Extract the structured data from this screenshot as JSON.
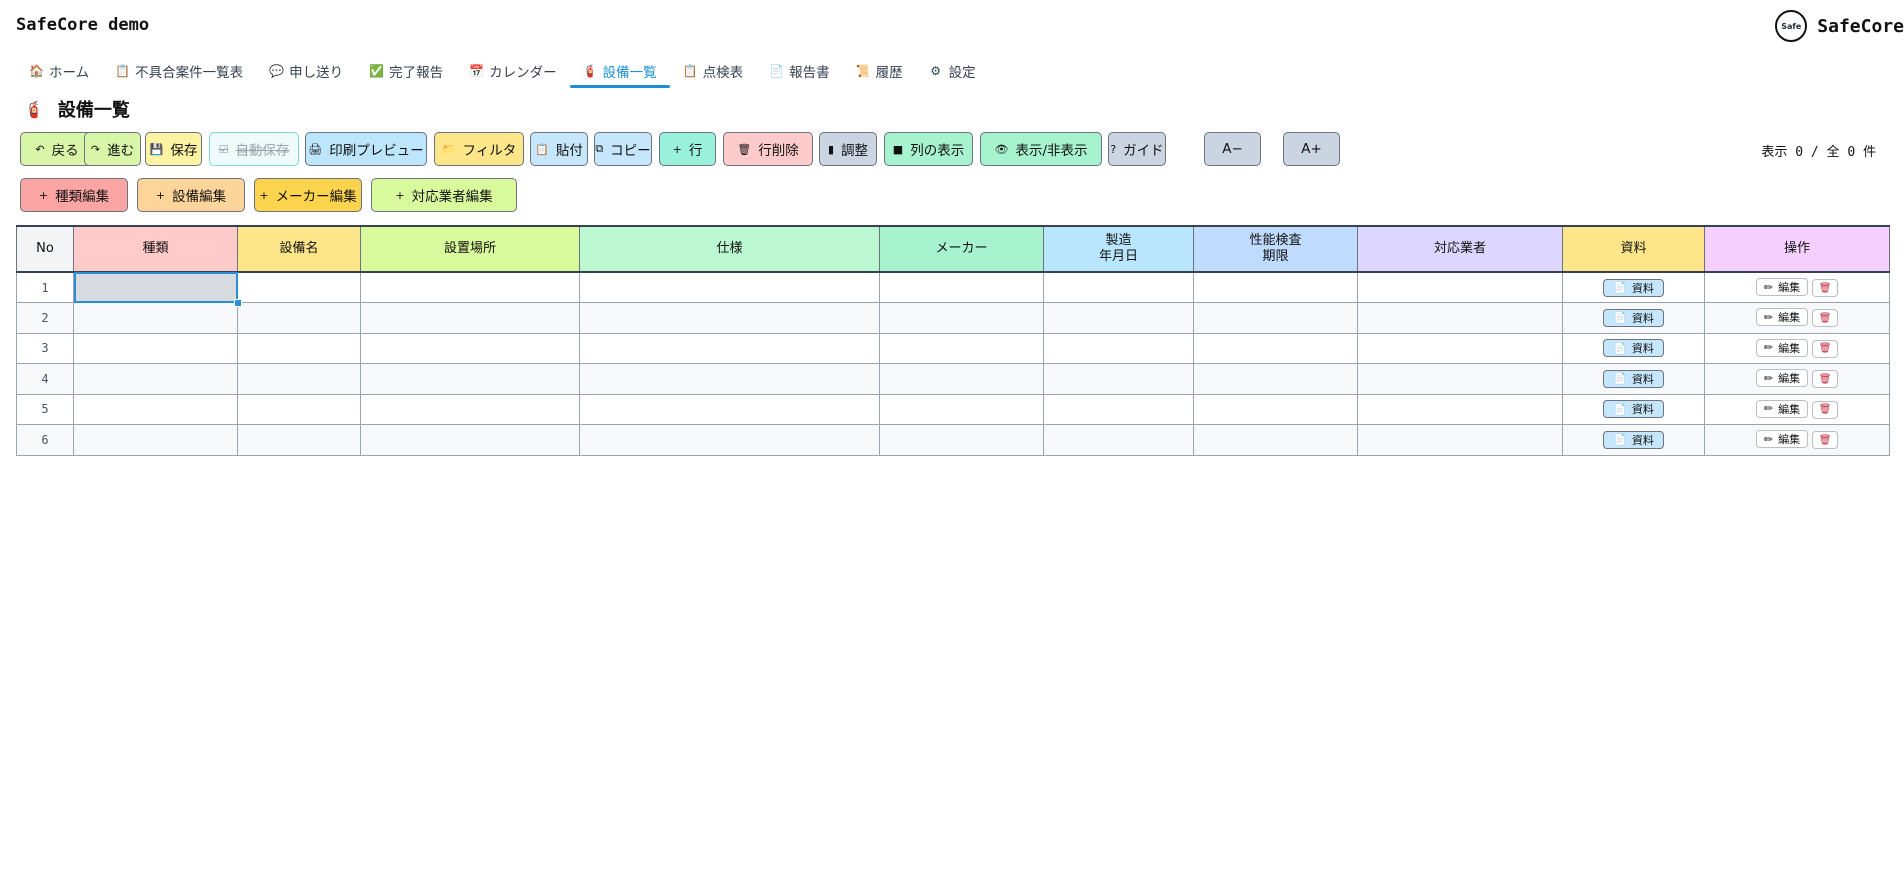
{
  "app": {
    "title": "SafeCore demo",
    "brand": "SafeCore",
    "logo_text": "Safe"
  },
  "nav": [
    {
      "icon": "🏠",
      "label": "ホーム"
    },
    {
      "icon": "📋",
      "label": "不具合案件一覧表"
    },
    {
      "icon": "💬",
      "label": "申し送り"
    },
    {
      "icon": "✅",
      "label": "完了報告"
    },
    {
      "icon": "📅",
      "label": "カレンダー"
    },
    {
      "icon": "🧯",
      "label": "設備一覧",
      "active": true
    },
    {
      "icon": "📋",
      "label": "点検表"
    },
    {
      "icon": "📄",
      "label": "報告書"
    },
    {
      "icon": "📜",
      "label": "履歴"
    },
    {
      "icon": "⚙",
      "label": "設定"
    }
  ],
  "page": {
    "icon": "🧯",
    "title": "設備一覧"
  },
  "toolbar": {
    "buttons": [
      {
        "icon": "↶",
        "label": "戻る",
        "color": "#d8f5a8"
      },
      {
        "icon": "↷",
        "label": "進む",
        "color": "#d8f5a8"
      },
      {
        "icon": "💾",
        "label": "保存",
        "color": "#fdf3a3"
      },
      {
        "icon": "☑",
        "label": "自動保存",
        "color": "#eefbfa",
        "disabled": true
      },
      {
        "icon": "🖨",
        "label": "印刷プレビュー",
        "color": "#bde5fb"
      },
      {
        "icon": "📁",
        "label": "フィルタ",
        "color": "#fde68a"
      },
      {
        "icon": "📋",
        "label": "貼付",
        "color": "#c6e6fb"
      },
      {
        "icon": "⧉",
        "label": "コピー",
        "color": "#c6e6fb"
      },
      {
        "icon": "+",
        "label": "行",
        "color": "#99f1dc"
      },
      {
        "icon": "🗑",
        "label": "行削除",
        "color": "#fecaca"
      },
      {
        "icon": "▮",
        "label": "調整",
        "color": "#cbd5e1"
      },
      {
        "icon": "■",
        "label": "列の表示",
        "color": "#a7f3d0"
      },
      {
        "icon": "👁",
        "label": "表示/非表示",
        "color": "#a7f3d0"
      },
      {
        "icon": "?",
        "label": "ガイド",
        "color": "#cbd5e1"
      },
      {
        "icon": "",
        "label": "A−",
        "color": "#cbd5e1"
      },
      {
        "icon": "",
        "label": "A+",
        "color": "#cbd5e1"
      }
    ],
    "count_label": "表示 0 / 全 0 件"
  },
  "toolbar2": {
    "buttons": [
      {
        "icon": "+",
        "label": "種類編集",
        "color": "#fca5a5"
      },
      {
        "icon": "+",
        "label": "設備編集",
        "color": "#fdd59b"
      },
      {
        "icon": "+",
        "label": "メーカー編集",
        "color": "#fcd34d"
      },
      {
        "icon": "+",
        "label": "対応業者編集",
        "color": "#d9f99d"
      }
    ]
  },
  "table": {
    "columns": [
      {
        "label": "No",
        "color": "#f3f4f6"
      },
      {
        "label": "種類",
        "color": "#fecaca"
      },
      {
        "label": "設備名",
        "color": "#fde68a"
      },
      {
        "label": "設置場所",
        "color": "#d9f99d"
      },
      {
        "label": "仕様",
        "color": "#bbf7d0"
      },
      {
        "label": "メーカー",
        "color": "#a7f3d0"
      },
      {
        "label": "製造\n年月日",
        "color": "#bae6fd"
      },
      {
        "label": "性能検査\n期限",
        "color": "#bfdbfe"
      },
      {
        "label": "対応業者",
        "color": "#ddd6fe"
      },
      {
        "label": "資料",
        "color": "#fde68a"
      },
      {
        "label": "操作",
        "color": "#f5d0fe"
      }
    ],
    "rows": [
      "1",
      "2",
      "3",
      "4",
      "5",
      "6"
    ],
    "doc_button": {
      "icon": "📄",
      "label": "資料"
    },
    "edit_button": {
      "icon": "✏",
      "label": "編集"
    },
    "delete_icon": "🗑"
  }
}
